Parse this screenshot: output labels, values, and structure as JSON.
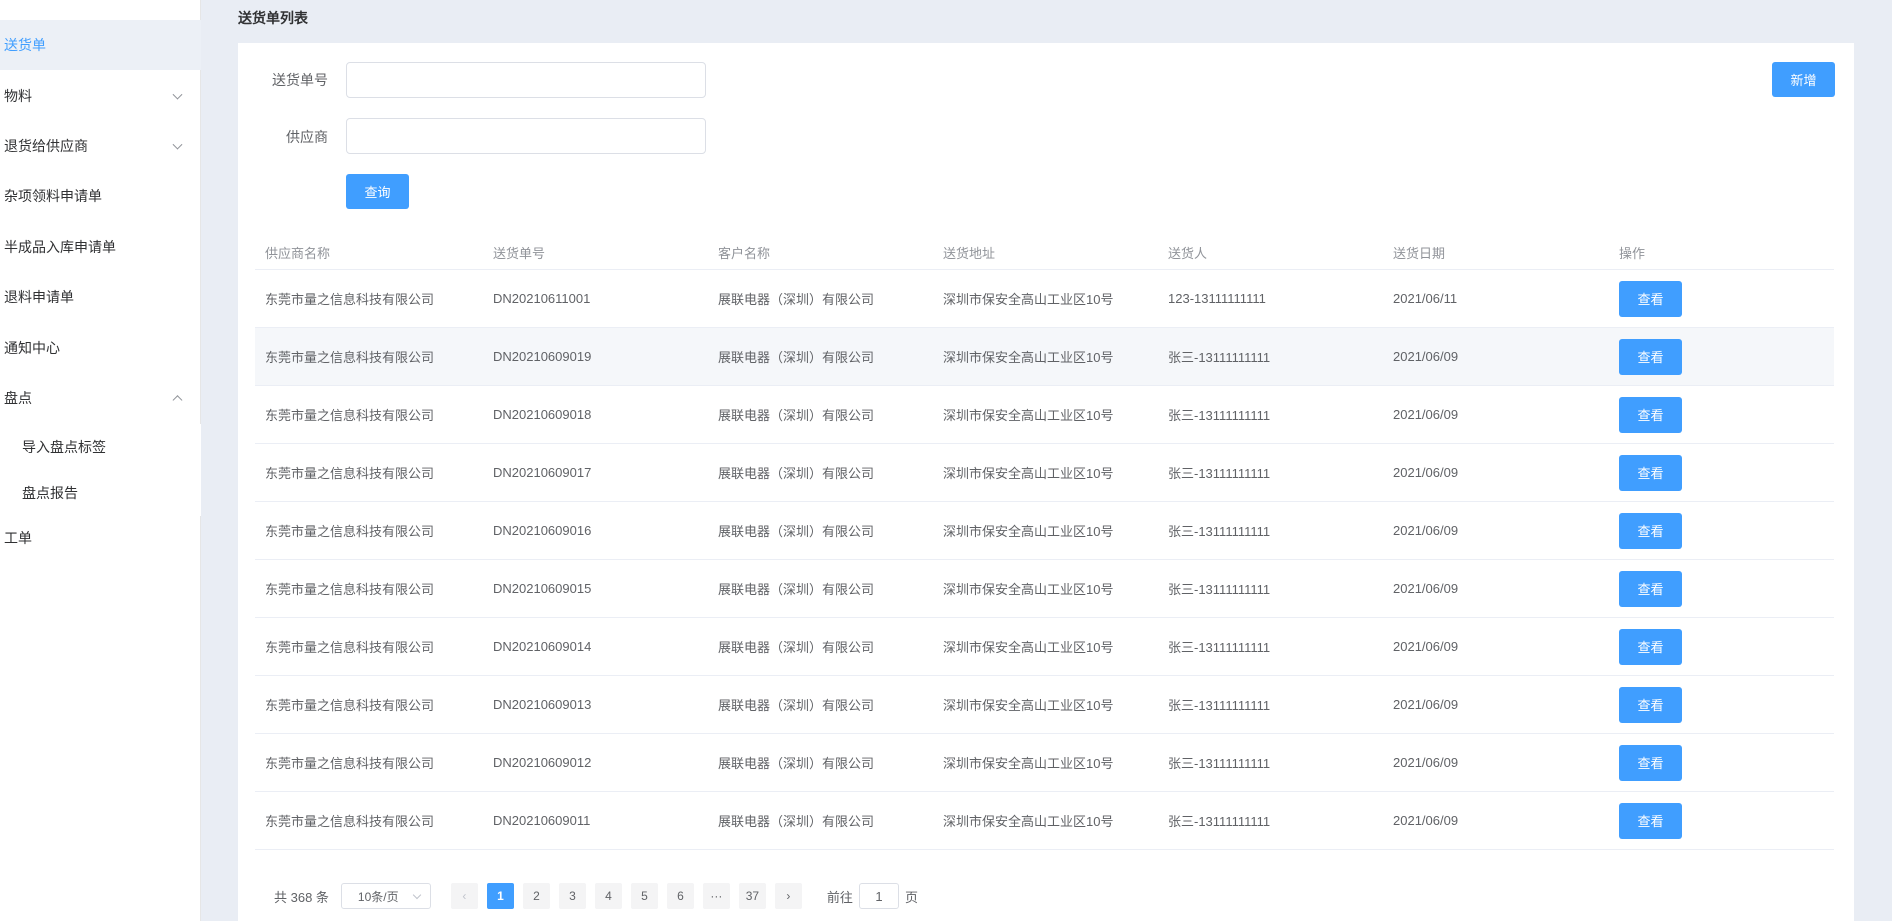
{
  "sidebar": {
    "items": [
      {
        "label": "送货单",
        "active": true
      },
      {
        "label": "物料",
        "chevron": "down"
      },
      {
        "label": "退货给供应商",
        "chevron": "down"
      },
      {
        "label": "杂项领料申请单"
      },
      {
        "label": "半成品入库申请单"
      },
      {
        "label": "退料申请单"
      },
      {
        "label": "通知中心"
      },
      {
        "label": "盘点",
        "chevron": "up"
      },
      {
        "label": "工单"
      }
    ],
    "sub_items": [
      {
        "label": "导入盘点标签"
      },
      {
        "label": "盘点报告"
      }
    ]
  },
  "page_title": "送货单列表",
  "form": {
    "delivery_no_label": "送货单号",
    "delivery_no_value": "",
    "supplier_label": "供应商",
    "supplier_value": "",
    "query_label": "查询",
    "add_label": "新增"
  },
  "table": {
    "columns": [
      "供应商名称",
      "送货单号",
      "客户名称",
      "送货地址",
      "送货人",
      "送货日期",
      "操作"
    ],
    "view_label": "查看",
    "rows": [
      {
        "supplier": "东莞市量之信息科技有限公司",
        "no": "DN20210611001",
        "customer": "展联电器（深圳）有限公司",
        "address": "深圳市保安全高山工业区10号",
        "person": "123-13111111111",
        "date": "2021/06/11"
      },
      {
        "supplier": "东莞市量之信息科技有限公司",
        "no": "DN20210609019",
        "customer": "展联电器（深圳）有限公司",
        "address": "深圳市保安全高山工业区10号",
        "person": "张三-13111111111",
        "date": "2021/06/09"
      },
      {
        "supplier": "东莞市量之信息科技有限公司",
        "no": "DN20210609018",
        "customer": "展联电器（深圳）有限公司",
        "address": "深圳市保安全高山工业区10号",
        "person": "张三-13111111111",
        "date": "2021/06/09"
      },
      {
        "supplier": "东莞市量之信息科技有限公司",
        "no": "DN20210609017",
        "customer": "展联电器（深圳）有限公司",
        "address": "深圳市保安全高山工业区10号",
        "person": "张三-13111111111",
        "date": "2021/06/09"
      },
      {
        "supplier": "东莞市量之信息科技有限公司",
        "no": "DN20210609016",
        "customer": "展联电器（深圳）有限公司",
        "address": "深圳市保安全高山工业区10号",
        "person": "张三-13111111111",
        "date": "2021/06/09"
      },
      {
        "supplier": "东莞市量之信息科技有限公司",
        "no": "DN20210609015",
        "customer": "展联电器（深圳）有限公司",
        "address": "深圳市保安全高山工业区10号",
        "person": "张三-13111111111",
        "date": "2021/06/09"
      },
      {
        "supplier": "东莞市量之信息科技有限公司",
        "no": "DN20210609014",
        "customer": "展联电器（深圳）有限公司",
        "address": "深圳市保安全高山工业区10号",
        "person": "张三-13111111111",
        "date": "2021/06/09"
      },
      {
        "supplier": "东莞市量之信息科技有限公司",
        "no": "DN20210609013",
        "customer": "展联电器（深圳）有限公司",
        "address": "深圳市保安全高山工业区10号",
        "person": "张三-13111111111",
        "date": "2021/06/09"
      },
      {
        "supplier": "东莞市量之信息科技有限公司",
        "no": "DN20210609012",
        "customer": "展联电器（深圳）有限公司",
        "address": "深圳市保安全高山工业区10号",
        "person": "张三-13111111111",
        "date": "2021/06/09"
      },
      {
        "supplier": "东莞市量之信息科技有限公司",
        "no": "DN20210609011",
        "customer": "展联电器（深圳）有限公司",
        "address": "深圳市保安全高山工业区10号",
        "person": "张三-13111111111",
        "date": "2021/06/09"
      }
    ]
  },
  "pagination": {
    "total_text": "共 368 条",
    "page_size": "10条/页",
    "prev": "‹",
    "next": "›",
    "pages": [
      "1",
      "2",
      "3",
      "4",
      "5",
      "6",
      "···",
      "37"
    ],
    "current": "1",
    "goto_prefix": "前往",
    "goto_value": "1",
    "goto_suffix": "页"
  },
  "colors": {
    "primary": "#409eff",
    "background": "#e9edf4"
  }
}
